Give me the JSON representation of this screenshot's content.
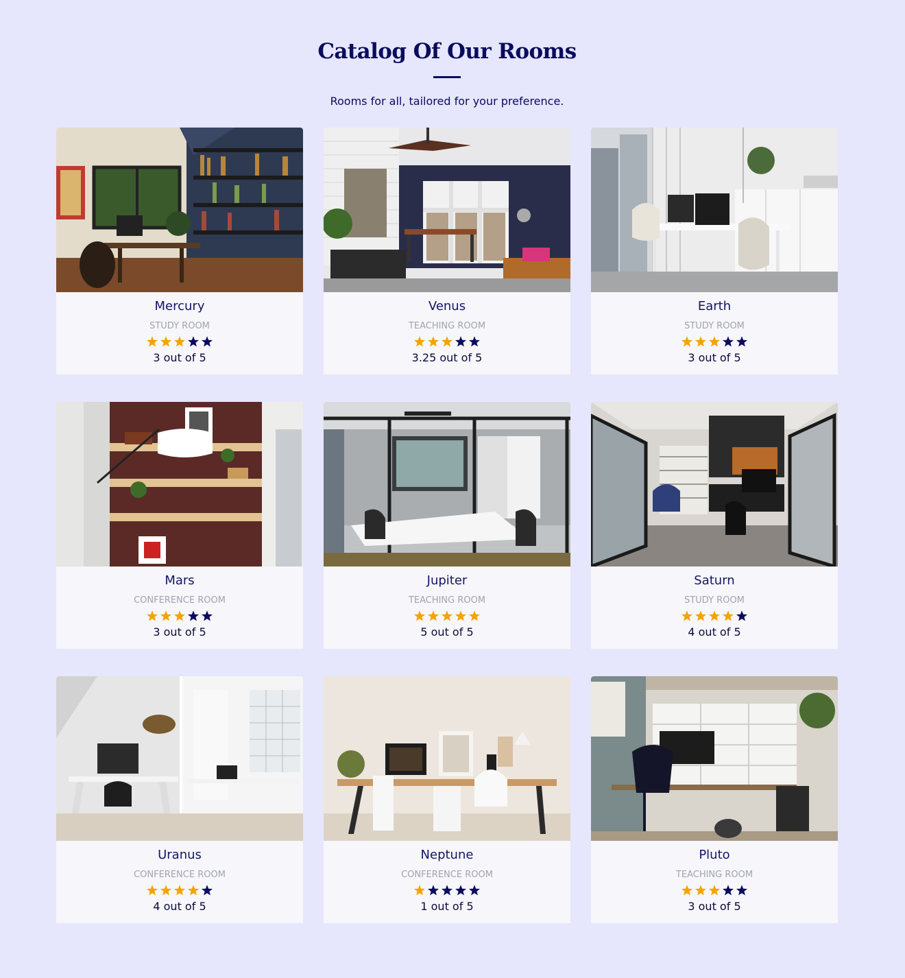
{
  "header": {
    "title": "Catalog Of Our Rooms",
    "subtitle": "Rooms for all, tailored for your preference."
  },
  "colors": {
    "background": "#e6e6fc",
    "heading": "#0b0b5e",
    "star_filled": "#f5a300",
    "star_empty": "#0b0b5e",
    "card": "#f6f6fb"
  },
  "rooms": [
    {
      "name": "Mercury",
      "type": "STUDY ROOM",
      "rating": 3,
      "stars_filled": 3,
      "rating_text": "3 out of 5",
      "photo": "study-room-dark-shelves-photo"
    },
    {
      "name": "Venus",
      "type": "TEACHING ROOM",
      "rating": 3.25,
      "stars_filled": 3,
      "rating_text": "3.25 out of 5",
      "photo": "office-ceiling-fan-photo"
    },
    {
      "name": "Earth",
      "type": "STUDY ROOM",
      "rating": 3,
      "stars_filled": 3,
      "rating_text": "3 out of 5",
      "photo": "white-office-desk-photo"
    },
    {
      "name": "Mars",
      "type": "CONFERENCE ROOM",
      "rating": 3,
      "stars_filled": 3,
      "rating_text": "3 out of 5",
      "photo": "wall-shelves-lamp-photo"
    },
    {
      "name": "Jupiter",
      "type": "TEACHING ROOM",
      "rating": 5,
      "stars_filled": 5,
      "rating_text": "5 out of 5",
      "photo": "glass-meeting-room-photo"
    },
    {
      "name": "Saturn",
      "type": "STUDY ROOM",
      "rating": 4,
      "stars_filled": 4,
      "rating_text": "4 out of 5",
      "photo": "industrial-office-photo"
    },
    {
      "name": "Uranus",
      "type": "CONFERENCE ROOM",
      "rating": 4,
      "stars_filled": 4,
      "rating_text": "4 out of 5",
      "photo": "white-desk-collage-photo"
    },
    {
      "name": "Neptune",
      "type": "CONFERENCE ROOM",
      "rating": 1,
      "stars_filled": 1,
      "rating_text": "1 out of 5",
      "photo": "minimal-desk-photo"
    },
    {
      "name": "Pluto",
      "type": "TEACHING ROOM",
      "rating": 3,
      "stars_filled": 3,
      "rating_text": "3 out of 5",
      "photo": "home-office-mesh-chair-photo"
    }
  ]
}
